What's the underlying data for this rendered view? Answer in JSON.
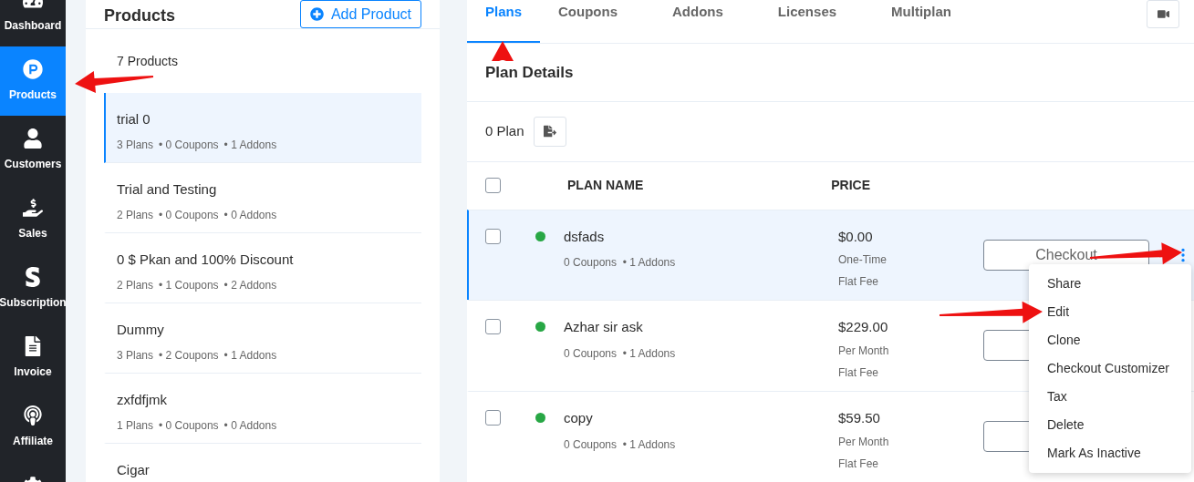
{
  "sidebar": {
    "items": [
      {
        "label": "Dashboard",
        "selected": false
      },
      {
        "label": "Products",
        "selected": true
      },
      {
        "label": "Customers",
        "selected": false
      },
      {
        "label": "Sales",
        "selected": false
      },
      {
        "label": "Subscription",
        "selected": false
      },
      {
        "label": "Invoice",
        "selected": false
      },
      {
        "label": "Affiliate",
        "selected": false
      }
    ]
  },
  "products_panel": {
    "title": "Products",
    "add_button": "Add Product",
    "count": "7 Products",
    "items": [
      {
        "name": "trial 0",
        "plans": "3 Plans",
        "coupons": "• 0 Coupons",
        "addons": "• 1 Addons",
        "selected": true
      },
      {
        "name": "Trial and Testing",
        "plans": "2 Plans",
        "coupons": "• 0 Coupons",
        "addons": "• 0 Addons",
        "selected": false
      },
      {
        "name": "0 $ Pkan and 100% Discount",
        "plans": "2 Plans",
        "coupons": "• 1 Coupons",
        "addons": "• 2 Addons",
        "selected": false
      },
      {
        "name": "Dummy",
        "plans": "3 Plans",
        "coupons": "• 2 Coupons",
        "addons": "• 1 Addons",
        "selected": false
      },
      {
        "name": "zxfdfjmk",
        "plans": "1 Plans",
        "coupons": "• 0 Coupons",
        "addons": "• 0 Addons",
        "selected": false
      },
      {
        "name": "Cigar",
        "selected": false
      }
    ]
  },
  "tabs": [
    {
      "label": "Plans",
      "selected": true
    },
    {
      "label": "Coupons",
      "selected": false
    },
    {
      "label": "Addons",
      "selected": false
    },
    {
      "label": "Licenses",
      "selected": false
    },
    {
      "label": "Multiplan",
      "selected": false
    }
  ],
  "plan_details": {
    "title": "Plan Details",
    "count": "0 Plan",
    "columns": [
      "PLAN NAME",
      "PRICE"
    ],
    "header_checked": false,
    "rows": [
      {
        "name": "dsfads",
        "meta": "0 Coupons  • 1 Addons",
        "price": "$0.00",
        "period": "One-Time",
        "fee": "Flat Fee",
        "color": "#28a745",
        "checked": false,
        "selected": true,
        "button": "Checkout"
      },
      {
        "name": "Azhar sir ask",
        "meta": "0 Coupons  • 1 Addons",
        "price": "$229.00",
        "period": "Per Month",
        "fee": "Flat Fee",
        "color": "#28a745",
        "checked": false,
        "selected": false
      },
      {
        "name": "copy",
        "meta": "0 Coupons  • 1 Addons",
        "price": "$59.50",
        "period": "Per Month",
        "fee": "Flat Fee",
        "color": "#28a745",
        "checked": false,
        "selected": false
      }
    ]
  },
  "menu": {
    "items": [
      "Share",
      "Edit",
      "Clone",
      "Checkout Customizer",
      "Tax",
      "Delete",
      "Mark As Inactive"
    ]
  }
}
